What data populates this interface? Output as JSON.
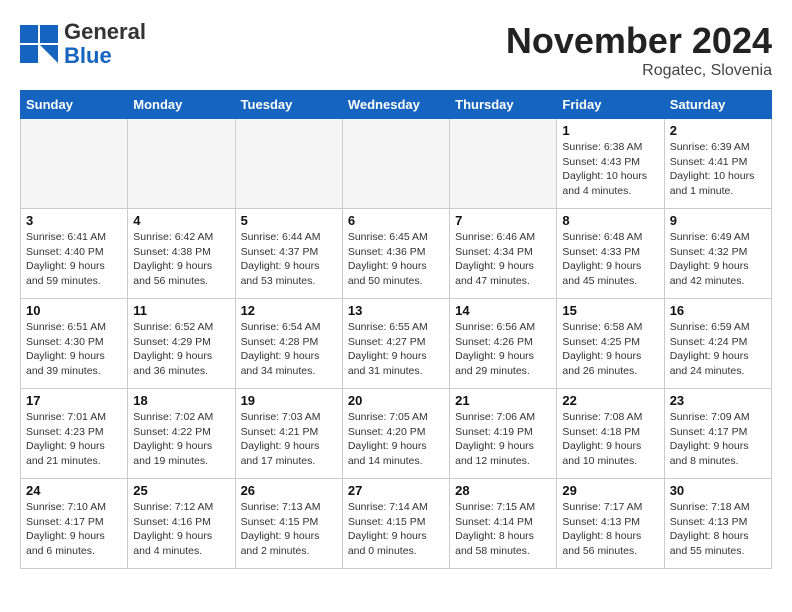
{
  "header": {
    "logo_general": "General",
    "logo_blue": "Blue",
    "month_title": "November 2024",
    "location": "Rogatec, Slovenia"
  },
  "weekdays": [
    "Sunday",
    "Monday",
    "Tuesday",
    "Wednesday",
    "Thursday",
    "Friday",
    "Saturday"
  ],
  "weeks": [
    [
      {
        "day": "",
        "info": ""
      },
      {
        "day": "",
        "info": ""
      },
      {
        "day": "",
        "info": ""
      },
      {
        "day": "",
        "info": ""
      },
      {
        "day": "",
        "info": ""
      },
      {
        "day": "1",
        "info": "Sunrise: 6:38 AM\nSunset: 4:43 PM\nDaylight: 10 hours\nand 4 minutes."
      },
      {
        "day": "2",
        "info": "Sunrise: 6:39 AM\nSunset: 4:41 PM\nDaylight: 10 hours\nand 1 minute."
      }
    ],
    [
      {
        "day": "3",
        "info": "Sunrise: 6:41 AM\nSunset: 4:40 PM\nDaylight: 9 hours\nand 59 minutes."
      },
      {
        "day": "4",
        "info": "Sunrise: 6:42 AM\nSunset: 4:38 PM\nDaylight: 9 hours\nand 56 minutes."
      },
      {
        "day": "5",
        "info": "Sunrise: 6:44 AM\nSunset: 4:37 PM\nDaylight: 9 hours\nand 53 minutes."
      },
      {
        "day": "6",
        "info": "Sunrise: 6:45 AM\nSunset: 4:36 PM\nDaylight: 9 hours\nand 50 minutes."
      },
      {
        "day": "7",
        "info": "Sunrise: 6:46 AM\nSunset: 4:34 PM\nDaylight: 9 hours\nand 47 minutes."
      },
      {
        "day": "8",
        "info": "Sunrise: 6:48 AM\nSunset: 4:33 PM\nDaylight: 9 hours\nand 45 minutes."
      },
      {
        "day": "9",
        "info": "Sunrise: 6:49 AM\nSunset: 4:32 PM\nDaylight: 9 hours\nand 42 minutes."
      }
    ],
    [
      {
        "day": "10",
        "info": "Sunrise: 6:51 AM\nSunset: 4:30 PM\nDaylight: 9 hours\nand 39 minutes."
      },
      {
        "day": "11",
        "info": "Sunrise: 6:52 AM\nSunset: 4:29 PM\nDaylight: 9 hours\nand 36 minutes."
      },
      {
        "day": "12",
        "info": "Sunrise: 6:54 AM\nSunset: 4:28 PM\nDaylight: 9 hours\nand 34 minutes."
      },
      {
        "day": "13",
        "info": "Sunrise: 6:55 AM\nSunset: 4:27 PM\nDaylight: 9 hours\nand 31 minutes."
      },
      {
        "day": "14",
        "info": "Sunrise: 6:56 AM\nSunset: 4:26 PM\nDaylight: 9 hours\nand 29 minutes."
      },
      {
        "day": "15",
        "info": "Sunrise: 6:58 AM\nSunset: 4:25 PM\nDaylight: 9 hours\nand 26 minutes."
      },
      {
        "day": "16",
        "info": "Sunrise: 6:59 AM\nSunset: 4:24 PM\nDaylight: 9 hours\nand 24 minutes."
      }
    ],
    [
      {
        "day": "17",
        "info": "Sunrise: 7:01 AM\nSunset: 4:23 PM\nDaylight: 9 hours\nand 21 minutes."
      },
      {
        "day": "18",
        "info": "Sunrise: 7:02 AM\nSunset: 4:22 PM\nDaylight: 9 hours\nand 19 minutes."
      },
      {
        "day": "19",
        "info": "Sunrise: 7:03 AM\nSunset: 4:21 PM\nDaylight: 9 hours\nand 17 minutes."
      },
      {
        "day": "20",
        "info": "Sunrise: 7:05 AM\nSunset: 4:20 PM\nDaylight: 9 hours\nand 14 minutes."
      },
      {
        "day": "21",
        "info": "Sunrise: 7:06 AM\nSunset: 4:19 PM\nDaylight: 9 hours\nand 12 minutes."
      },
      {
        "day": "22",
        "info": "Sunrise: 7:08 AM\nSunset: 4:18 PM\nDaylight: 9 hours\nand 10 minutes."
      },
      {
        "day": "23",
        "info": "Sunrise: 7:09 AM\nSunset: 4:17 PM\nDaylight: 9 hours\nand 8 minutes."
      }
    ],
    [
      {
        "day": "24",
        "info": "Sunrise: 7:10 AM\nSunset: 4:17 PM\nDaylight: 9 hours\nand 6 minutes."
      },
      {
        "day": "25",
        "info": "Sunrise: 7:12 AM\nSunset: 4:16 PM\nDaylight: 9 hours\nand 4 minutes."
      },
      {
        "day": "26",
        "info": "Sunrise: 7:13 AM\nSunset: 4:15 PM\nDaylight: 9 hours\nand 2 minutes."
      },
      {
        "day": "27",
        "info": "Sunrise: 7:14 AM\nSunset: 4:15 PM\nDaylight: 9 hours\nand 0 minutes."
      },
      {
        "day": "28",
        "info": "Sunrise: 7:15 AM\nSunset: 4:14 PM\nDaylight: 8 hours\nand 58 minutes."
      },
      {
        "day": "29",
        "info": "Sunrise: 7:17 AM\nSunset: 4:13 PM\nDaylight: 8 hours\nand 56 minutes."
      },
      {
        "day": "30",
        "info": "Sunrise: 7:18 AM\nSunset: 4:13 PM\nDaylight: 8 hours\nand 55 minutes."
      }
    ]
  ]
}
